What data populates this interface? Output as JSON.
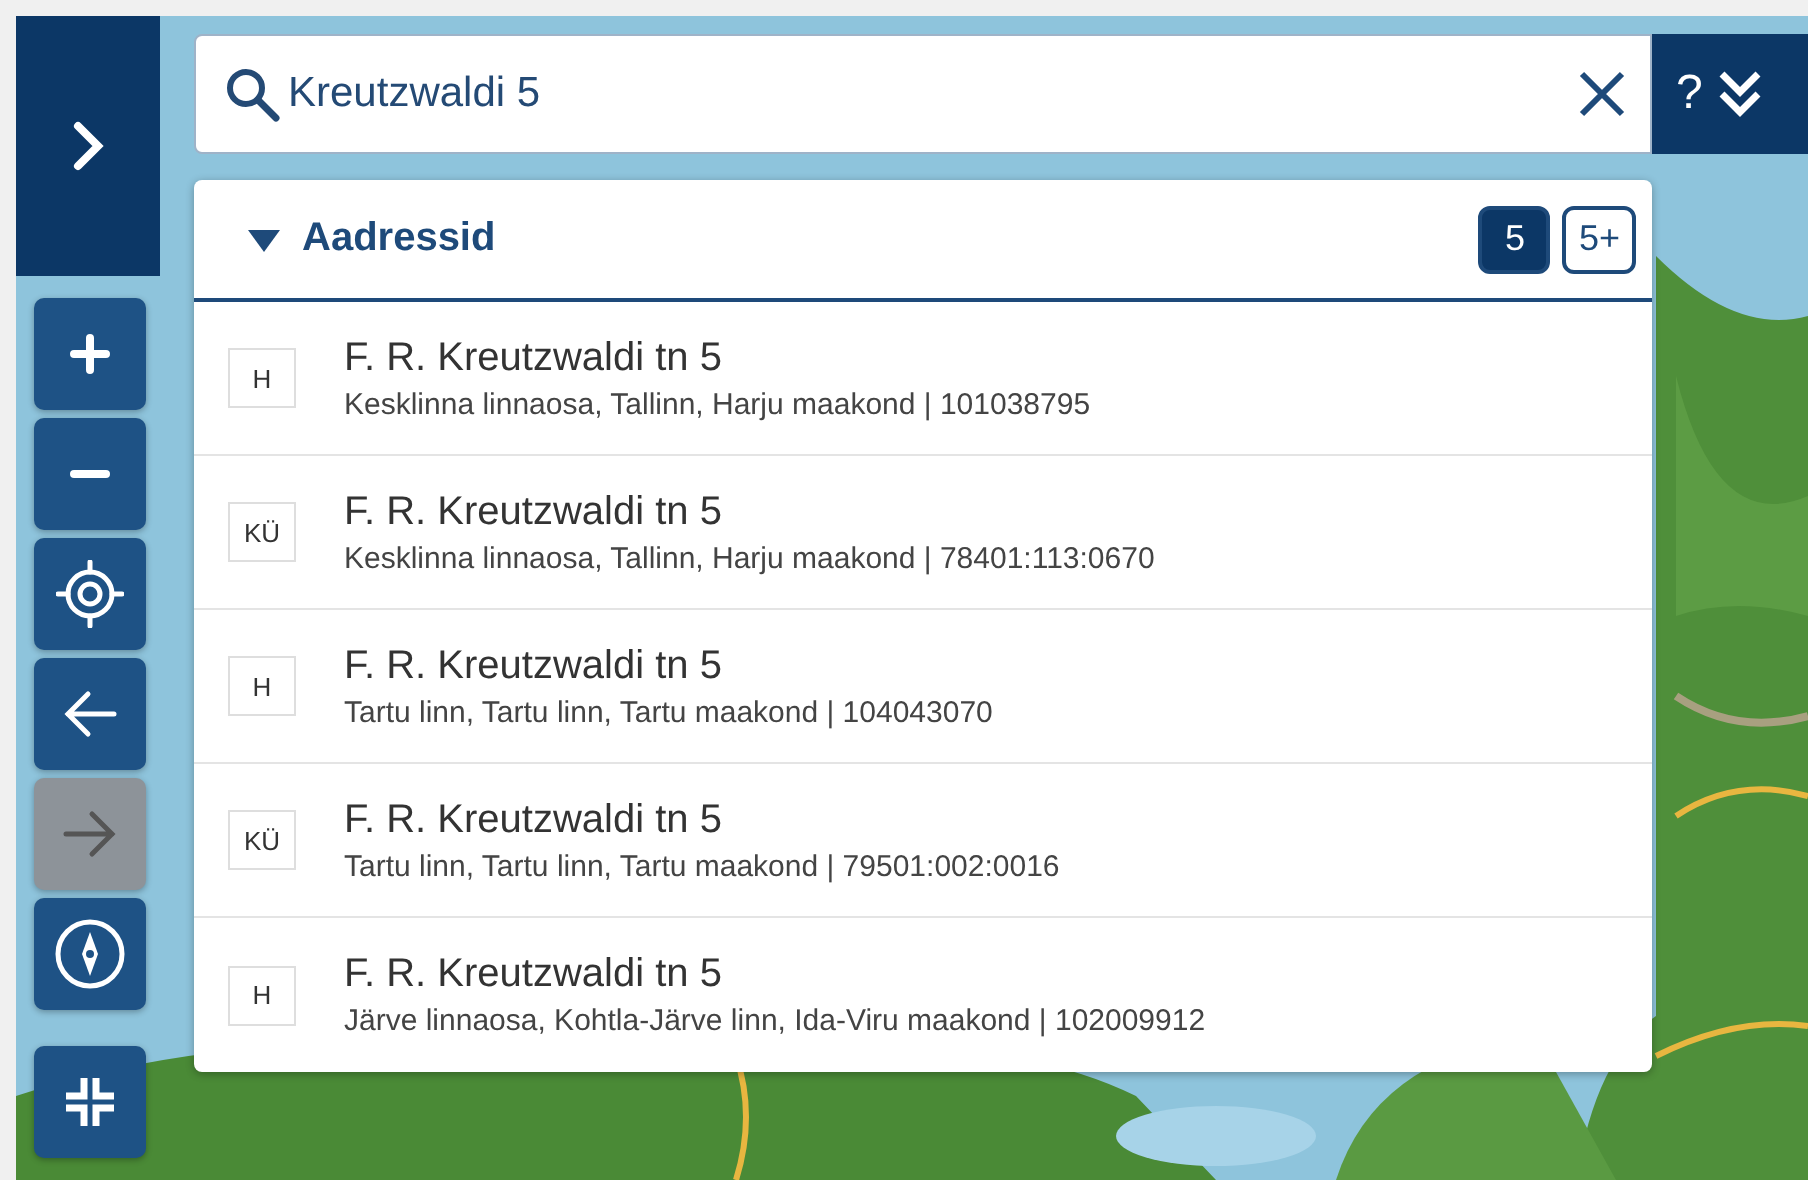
{
  "tools": [
    {
      "kind": "zoom-in",
      "disabled": false
    },
    {
      "kind": "zoom-out",
      "disabled": false
    },
    {
      "kind": "locate",
      "disabled": false
    },
    {
      "kind": "back",
      "disabled": false
    },
    {
      "kind": "forward",
      "disabled": true
    },
    {
      "kind": "compass",
      "disabled": false
    }
  ],
  "search": {
    "value": "Kreutzwaldi 5",
    "help": "?"
  },
  "results": {
    "label": "Aadressid",
    "expanded": true,
    "counts": [
      {
        "label": "5",
        "selected": true
      },
      {
        "label": "5+",
        "selected": false
      }
    ],
    "items": [
      {
        "type": "H",
        "title": "F. R. Kreutzwaldi tn 5",
        "detail": "Kesklinna linnaosa, Tallinn, Harju maakond | 101038795"
      },
      {
        "type": "KÜ",
        "title": "F. R. Kreutzwaldi tn 5",
        "detail": "Kesklinna linnaosa, Tallinn, Harju maakond | 78401:113:0670"
      },
      {
        "type": "H",
        "title": "F. R. Kreutzwaldi tn 5",
        "detail": "Tartu linn, Tartu linn, Tartu maakond | 104043070"
      },
      {
        "type": "KÜ",
        "title": "F. R. Kreutzwaldi tn 5",
        "detail": "Tartu linn, Tartu linn, Tartu maakond | 79501:002:0016"
      },
      {
        "type": "H",
        "title": "F. R. Kreutzwaldi tn 5",
        "detail": "Järve linnaosa, Kohtla-Järve linn, Ida-Viru maakond | 102009912"
      }
    ]
  }
}
